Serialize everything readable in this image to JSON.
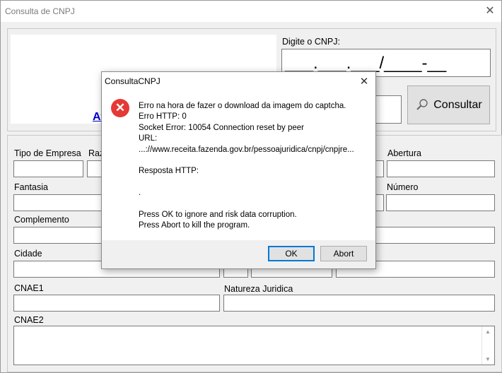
{
  "window": {
    "title": "Consulta de CNPJ"
  },
  "cnpj": {
    "label": "Digite o CNPJ:",
    "mask": "___.___.___/____-__"
  },
  "captcha": {
    "link_partial": "At"
  },
  "consultar_button": "Consultar",
  "fields": {
    "tipo_empresa": "Tipo de Empresa",
    "razao_partial": "Raz",
    "abertura": "Abertura",
    "fantasia": "Fantasia",
    "numero": "Número",
    "complemento": "Complemento",
    "cidade": "Cidade",
    "cnae1": "CNAE1",
    "natureza_juridica": "Natureza Juridica",
    "cnae2": "CNAE2"
  },
  "dialog": {
    "title": "ConsultaCNPJ",
    "message": "Erro na hora de fazer o download da imagem do captcha.\nErro HTTP: 0\nSocket Error: 10054 Connection reset by peer\nURL:\n...://www.receita.fazenda.gov.br/pessoajuridica/cnpj/cnpjre...\n\nResposta HTTP:\n\n.\n\nPress OK to ignore and risk data corruption.\nPress Abort to kill the program.",
    "ok_label": "OK",
    "abort_label": "Abort",
    "icon": "error-icon"
  }
}
